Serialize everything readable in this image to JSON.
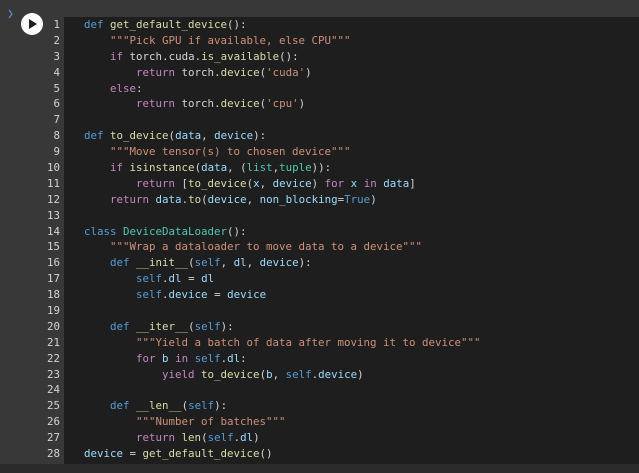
{
  "cell": {
    "run_button_label": "Run cell",
    "line_numbers": [
      "1",
      "2",
      "3",
      "4",
      "5",
      "6",
      "7",
      "8",
      "9",
      "10",
      "11",
      "12",
      "13",
      "14",
      "15",
      "16",
      "17",
      "18",
      "19",
      "20",
      "21",
      "22",
      "23",
      "24",
      "25",
      "26",
      "27",
      "28"
    ],
    "code_lines": [
      "def get_default_device():",
      "    \"\"\"Pick GPU if available, else CPU\"\"\"",
      "    if torch.cuda.is_available():",
      "        return torch.device('cuda')",
      "    else:",
      "        return torch.device('cpu')",
      "",
      "def to_device(data, device):",
      "    \"\"\"Move tensor(s) to chosen device\"\"\"",
      "    if isinstance(data, (list,tuple)):",
      "        return [to_device(x, device) for x in data]",
      "    return data.to(device, non_blocking=True)",
      "",
      "class DeviceDataLoader():",
      "    \"\"\"Wrap a dataloader to move data to a device\"\"\"",
      "    def __init__(self, dl, device):",
      "        self.dl = dl",
      "        self.device = device",
      "",
      "    def __iter__(self):",
      "        \"\"\"Yield a batch of data after moving it to device\"\"\"",
      "        for b in self.dl:",
      "            yield to_device(b, self.device)",
      "",
      "    def __len__(self):",
      "        \"\"\"Number of batches\"\"\"",
      "        return len(self.dl)",
      "device = get_default_device()"
    ]
  },
  "colors": {
    "keyword_def": "#569cd6",
    "keyword_flow": "#c586c0",
    "string": "#ce9178",
    "function": "#dcdcaa",
    "param": "#9cdcfe",
    "class_name": "#4ec9b0",
    "builtin_type": "#4ec9b0",
    "constant": "#569cd6",
    "default_text": "#d4d4d4",
    "editor_bg": "#1e1e1e",
    "cell_bg": "#383838"
  },
  "icons": {
    "run": "play-circle-icon",
    "marker": "execution-marker-icon"
  }
}
